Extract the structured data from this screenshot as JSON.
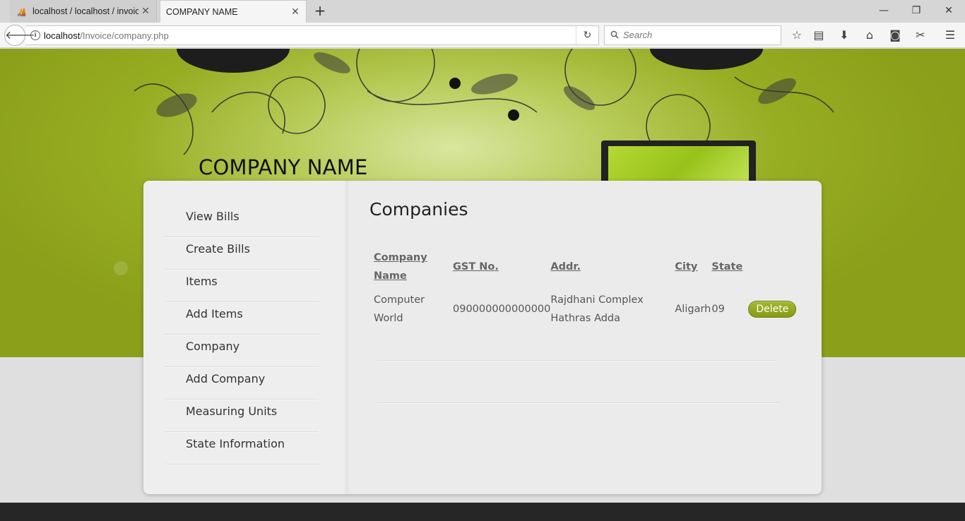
{
  "browser": {
    "tabs": [
      {
        "label": "localhost / localhost / invoic",
        "active": false
      },
      {
        "label": "COMPANY NAME",
        "active": true
      }
    ],
    "url_host": "localhost",
    "url_path": "/Invoice/company.php",
    "search_placeholder": "Search"
  },
  "site": {
    "title": "COMPANY NAME",
    "brand_color": "#8b9f1a"
  },
  "sidebar": {
    "items": [
      {
        "label": "View Bills"
      },
      {
        "label": "Create Bills"
      },
      {
        "label": "Items"
      },
      {
        "label": "Add Items"
      },
      {
        "label": "Company"
      },
      {
        "label": "Add Company"
      },
      {
        "label": "Measuring Units"
      },
      {
        "label": "State Information"
      }
    ]
  },
  "main": {
    "heading": "Companies",
    "table": {
      "headers": {
        "name_line1": "Company",
        "name_line2": "Name",
        "gst": "GST No.",
        "addr": "Addr.",
        "city": "City",
        "state": "State"
      },
      "rows": [
        {
          "name_line1": "Computer",
          "name_line2": "World",
          "gst": "090000000000000",
          "addr_line1": "Rajdhani Complex",
          "addr_line2": "Hathras Adda",
          "city": "Aligarh",
          "state": "09",
          "action": "Delete"
        }
      ]
    }
  }
}
